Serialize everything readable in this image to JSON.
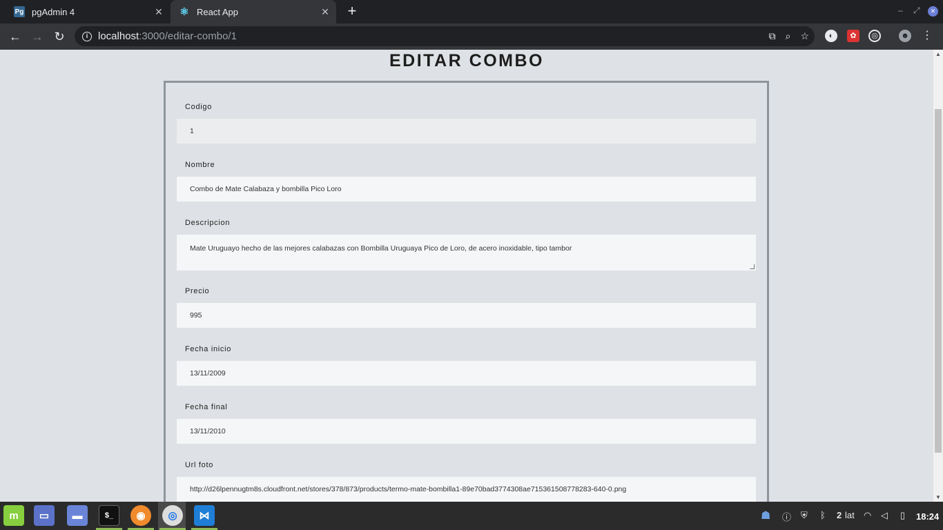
{
  "browser": {
    "tabs": [
      {
        "title": "pgAdmin 4",
        "favicon": "Pg"
      },
      {
        "title": "React App",
        "favicon": "react-icon"
      }
    ],
    "url_host": "localhost",
    "url_rest": ":3000/editar-combo/1"
  },
  "page": {
    "title": "EDITAR COMBO",
    "fields": [
      {
        "label": "Codigo",
        "value": "1"
      },
      {
        "label": "Nombre",
        "value": "Combo de Mate Calabaza y bombilla Pico Loro"
      },
      {
        "label": "Descripcion",
        "value": "Mate Uruguayo hecho de las mejores calabazas con Bombilla Uruguaya Pico de Loro, de acero inoxidable, tipo tambor"
      },
      {
        "label": "Precio",
        "value": "995"
      },
      {
        "label": "Fecha inicio",
        "value": "13/11/2009"
      },
      {
        "label": "Fecha final",
        "value": "13/11/2010"
      },
      {
        "label": "Url foto",
        "value": "http://d26lpennugtm8s.cloudfront.net/stores/378/873/products/termo-mate-bombilla1-89e70bad3774308ae715361508778283-640-0.png"
      }
    ]
  },
  "taskbar": {
    "workspace": "2",
    "keyboard_layout": "lat",
    "clock": "18:24"
  }
}
